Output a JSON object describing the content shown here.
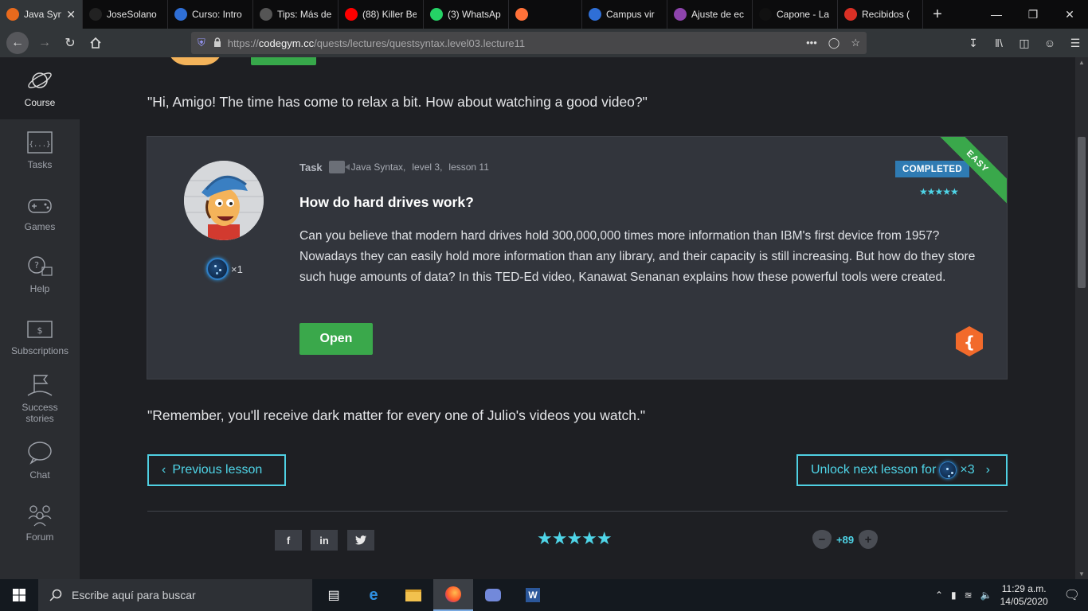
{
  "browser": {
    "tabs": [
      {
        "title": "Java Syn",
        "favicon_color": "#e86a1d",
        "active": true
      },
      {
        "title": "JoseSolano",
        "favicon_color": "#222222"
      },
      {
        "title": "Curso: Intro",
        "favicon_color": "#2f6fd6"
      },
      {
        "title": "Tips: Más de",
        "favicon_color": "#555555"
      },
      {
        "title": "(88) Killer Be",
        "favicon_color": "#ff0000"
      },
      {
        "title": "(3) WhatsAp",
        "favicon_color": "#25d366"
      },
      {
        "title": "",
        "favicon_color": "#ff7139"
      },
      {
        "title": "Campus vir",
        "favicon_color": "#2f6fd6"
      },
      {
        "title": "Ajuste de ec",
        "favicon_color": "#8e44ad"
      },
      {
        "title": "Capone - La",
        "favicon_color": "#111111"
      },
      {
        "title": "Recibidos (",
        "favicon_color": "#d93025"
      }
    ],
    "url_prefix": "https://",
    "url_domain": "codegym.cc",
    "url_path": "/quests/lectures/questsyntax.level03.lecture11"
  },
  "sidebar": {
    "items": [
      {
        "label": "Course",
        "icon": "planet-icon",
        "active": true
      },
      {
        "label": "Tasks",
        "icon": "code-window-icon"
      },
      {
        "label": "Games",
        "icon": "gamepad-icon"
      },
      {
        "label": "Help",
        "icon": "chat-question-icon"
      },
      {
        "label": "Subscriptions",
        "icon": "wallet-icon"
      },
      {
        "label": "Success stories",
        "icon": "flag-icon"
      },
      {
        "label": "Chat",
        "icon": "chat-bubble-icon"
      },
      {
        "label": "Forum",
        "icon": "people-icon"
      }
    ]
  },
  "lesson": {
    "intro_quote": "\"Hi, Amigo! The time has come to relax a bit. How about watching a good video?\"",
    "outro_quote": "\"Remember, you'll receive dark matter for every one of Julio's videos you watch.\"",
    "card": {
      "type_label": "Task",
      "course": "Java Syntax,",
      "level": "level 3,",
      "lesson": "lesson 11",
      "status": "COMPLETED",
      "difficulty": "EASY",
      "title": "How do hard drives work?",
      "description": "Can you believe that modern hard drives hold 300,000,000 times more information than IBM's first device from 1957? Nowadays they can easily hold more information than any library, and their capacity is still increasing. But how do they store such huge amounts of data? In this TED-Ed video, Kanawat Senanan explains how these powerful tools were created.",
      "reward": "×1",
      "open_label": "Open",
      "stars": "★★★★★"
    },
    "prev_label": "Previous lesson",
    "next_label": "Unlock next lesson for",
    "next_cost": "×3",
    "social": [
      "f",
      "in",
      "t"
    ],
    "rating_stars": "★★★★★",
    "votes": "+89"
  },
  "taskbar": {
    "search_placeholder": "Escribe aquí para buscar",
    "time": "11:29 a.m.",
    "date": "14/05/2020"
  },
  "colors": {
    "accent": "#4fd5e8",
    "green": "#3aa84b",
    "completed_blue": "#2f7bb3"
  }
}
